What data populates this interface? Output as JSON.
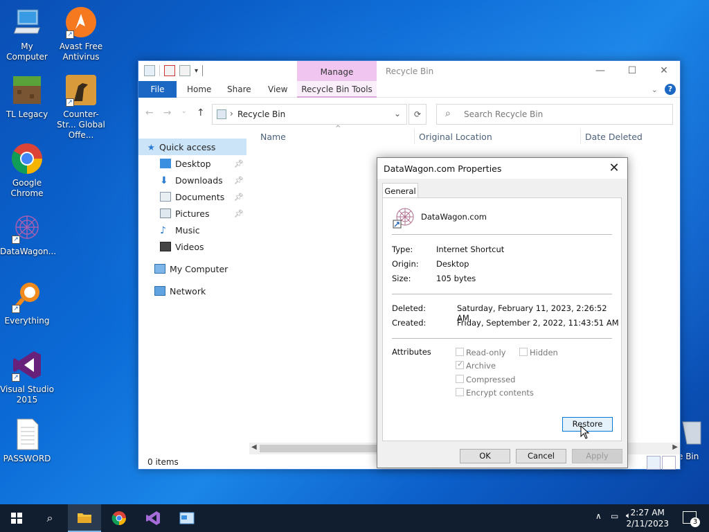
{
  "desktop": {
    "icons": [
      {
        "label": "My Computer"
      },
      {
        "label": "Avast Free Antivirus"
      },
      {
        "label": "TL Legacy"
      },
      {
        "label": "Counter-Str... Global Offe..."
      },
      {
        "label": "Google Chrome"
      },
      {
        "label": "DataWagon..."
      },
      {
        "label": "Everything"
      },
      {
        "label": "Visual Studio 2015"
      },
      {
        "label": "PASSWORD"
      }
    ],
    "recycle_bin_partial": "e Bin"
  },
  "explorer": {
    "manage_tab": "Manage",
    "title": "Recycle Bin",
    "ribbon": {
      "file": "File",
      "home": "Home",
      "share": "Share",
      "view": "View",
      "tools": "Recycle Bin Tools"
    },
    "address": "Recycle Bin",
    "search_placeholder": "Search Recycle Bin",
    "nav": {
      "quick_access": "Quick access",
      "desktop": "Desktop",
      "downloads": "Downloads",
      "documents": "Documents",
      "pictures": "Pictures",
      "music": "Music",
      "videos": "Videos",
      "my_computer": "My Computer",
      "network": "Network"
    },
    "columns": {
      "name": "Name",
      "original_location": "Original Location",
      "date_deleted": "Date Deleted"
    },
    "status": "0 items"
  },
  "dialog": {
    "title": "DataWagon.com Properties",
    "tab": "General",
    "file_name": "DataWagon.com",
    "type_label": "Type:",
    "type_value": "Internet Shortcut",
    "origin_label": "Origin:",
    "origin_value": "Desktop",
    "size_label": "Size:",
    "size_value": "105 bytes",
    "deleted_label": "Deleted:",
    "deleted_value": "Saturday, February 11, 2023, 2:26:52 AM",
    "created_label": "Created:",
    "created_value": "Friday, September 2, 2022, 11:43:51 AM",
    "attributes_label": "Attributes",
    "attr_readonly": "Read-only",
    "attr_hidden": "Hidden",
    "attr_archive": "Archive",
    "attr_compressed": "Compressed",
    "attr_encrypt": "Encrypt contents",
    "restore": "Restore",
    "ok": "OK",
    "cancel": "Cancel",
    "apply": "Apply"
  },
  "taskbar": {
    "time": "2:27 AM",
    "date": "2/11/2023",
    "notifications": "3"
  },
  "colors": {
    "accent": "#1a67c4",
    "manage_tab": "#f0c6f0",
    "taskbar": "#101e30"
  }
}
